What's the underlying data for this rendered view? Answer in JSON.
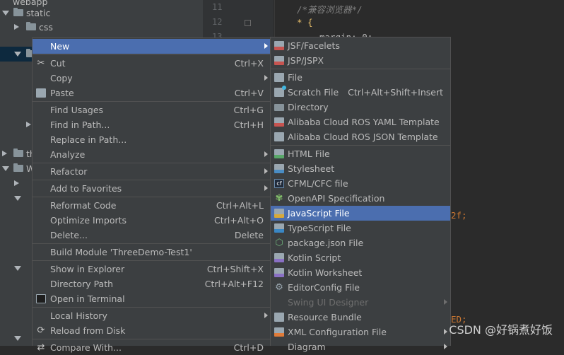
{
  "tree": {
    "rows": [
      "webapp",
      "static",
      "css",
      "th",
      "W"
    ]
  },
  "editor": {
    "line_numbers": [
      "11",
      "12",
      "13"
    ],
    "comment": "/*兼容浏览器*/",
    "selector": "* {",
    "margin_line": "margin: 0;",
    "partial_value": "2f;",
    "partial_const": "ED;"
  },
  "context_menu": {
    "items": [
      {
        "label": "New",
        "shortcut": "",
        "submenu": true
      },
      {
        "label": "Cut",
        "shortcut": "Ctrl+X",
        "icon": "scissors-icon"
      },
      {
        "label": "Copy",
        "shortcut": ""
      },
      {
        "label": "Paste",
        "shortcut": "Ctrl+V",
        "icon": "clipboard-icon"
      },
      {
        "label": "Find Usages",
        "shortcut": "Ctrl+G"
      },
      {
        "label": "Find in Path...",
        "shortcut": "Ctrl+H"
      },
      {
        "label": "Replace in Path...",
        "shortcut": ""
      },
      {
        "label": "Analyze",
        "shortcut": "",
        "submenu": true
      },
      {
        "label": "Refactor",
        "shortcut": "",
        "submenu": true
      },
      {
        "label": "Add to Favorites",
        "shortcut": "",
        "submenu": true
      },
      {
        "label": "Reformat Code",
        "shortcut": "Ctrl+Alt+L"
      },
      {
        "label": "Optimize Imports",
        "shortcut": "Ctrl+Alt+O"
      },
      {
        "label": "Delete...",
        "shortcut": "Delete"
      },
      {
        "label": "Build Module 'ThreeDemo-Test1'",
        "shortcut": ""
      },
      {
        "label": "Show in Explorer",
        "shortcut": "Ctrl+Shift+X"
      },
      {
        "label": "Directory Path",
        "shortcut": "Ctrl+Alt+F12"
      },
      {
        "label": "Open in Terminal",
        "shortcut": "",
        "icon": "terminal-icon"
      },
      {
        "label": "Local History",
        "shortcut": "",
        "submenu": true
      },
      {
        "label": "Reload from Disk",
        "shortcut": "",
        "icon": "reload-icon"
      },
      {
        "label": "Compare With...",
        "shortcut": "Ctrl+D"
      }
    ]
  },
  "new_submenu": {
    "items": [
      {
        "label": "JSF/Facelets",
        "icon": "jsf-file-icon"
      },
      {
        "label": "JSP/JSPX",
        "icon": "jsp-file-icon"
      },
      {
        "label": "File",
        "icon": "file-icon"
      },
      {
        "label": "Scratch File",
        "shortcut": "Ctrl+Alt+Shift+Insert",
        "icon": "scratch-file-icon"
      },
      {
        "label": "Directory",
        "icon": "folder-icon"
      },
      {
        "label": "Alibaba Cloud ROS YAML Template",
        "icon": "yaml-file-icon"
      },
      {
        "label": "Alibaba Cloud ROS JSON Template",
        "icon": "json-template-icon"
      },
      {
        "label": "HTML File",
        "icon": "html-file-icon"
      },
      {
        "label": "Stylesheet",
        "icon": "css-file-icon"
      },
      {
        "label": "CFML/CFC file",
        "icon": "cfml-file-icon"
      },
      {
        "label": "OpenAPI Specification",
        "icon": "openapi-icon"
      },
      {
        "label": "JavaScript File",
        "icon": "javascript-file-icon",
        "highlighted": true
      },
      {
        "label": "TypeScript File",
        "icon": "typescript-file-icon"
      },
      {
        "label": "package.json File",
        "icon": "package-json-icon"
      },
      {
        "label": "Kotlin Script",
        "icon": "kotlin-script-icon"
      },
      {
        "label": "Kotlin Worksheet",
        "icon": "kotlin-worksheet-icon"
      },
      {
        "label": "EditorConfig File",
        "icon": "editorconfig-icon"
      },
      {
        "label": "Swing UI Designer",
        "disabled": true
      },
      {
        "label": "Resource Bundle",
        "icon": "resource-bundle-icon"
      },
      {
        "label": "XML Configuration File",
        "icon": "xml-file-icon"
      },
      {
        "label": "Diagram"
      }
    ]
  },
  "watermark": "CSDN @好锅煮好饭",
  "colors": {
    "highlight": "#4b6eaf",
    "menu_bg": "#3c3f41",
    "editor_bg": "#2b2b2b"
  }
}
